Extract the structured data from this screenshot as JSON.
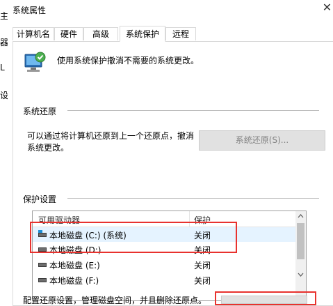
{
  "window": {
    "title": "系统属性",
    "close_glyph": "✕"
  },
  "background_chars": [
    "主",
    "器",
    "L",
    "设"
  ],
  "tabs": [
    {
      "label": "计算机名",
      "active": false
    },
    {
      "label": "硬件",
      "active": false
    },
    {
      "label": "高级",
      "active": false
    },
    {
      "label": "系统保护",
      "active": true
    },
    {
      "label": "远程",
      "active": false
    }
  ],
  "intro": {
    "text": "使用系统保护撤消不需要的系统更改。",
    "icon": "system-protection-icon"
  },
  "restore": {
    "heading": "系统还原",
    "description_line1": "可以通过将计算机还原到上一个还原点，撤消",
    "description_line2": "系统更改。",
    "button_label": "系统还原(S)..."
  },
  "protection": {
    "heading": "保护设置",
    "columns": [
      "可用驱动器",
      "保护"
    ],
    "rows": [
      {
        "name": "本地磁盘 (C:) (系统)",
        "status": "关闭",
        "selected": true
      },
      {
        "name": "本地磁盘 (D:)",
        "status": "关闭",
        "selected": false
      },
      {
        "name": "本地磁盘 (E:)",
        "status": "关闭",
        "selected": false
      },
      {
        "name": "本地磁盘 (F:)",
        "status": "关闭",
        "selected": false
      }
    ]
  },
  "configure": {
    "text": "配置还原设置，管理磁盘空间，并且删除还原点。"
  },
  "colors": {
    "highlight": "#e8322e",
    "selection": "#e5f3ff",
    "disabled_button": "#e1e1e1"
  }
}
